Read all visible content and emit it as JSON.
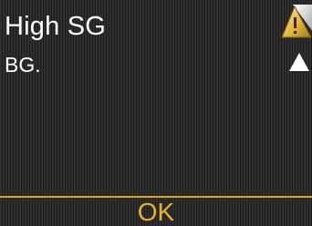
{
  "alert": {
    "title": "High SG",
    "message": "BG.",
    "icon": "warning-icon",
    "scroll_icon": "scroll-up-arrow-icon"
  },
  "actions": {
    "ok_label": "OK"
  },
  "colors": {
    "accent": "#e8b22a",
    "text": "#ffffff",
    "background": "#2a2a2a"
  }
}
